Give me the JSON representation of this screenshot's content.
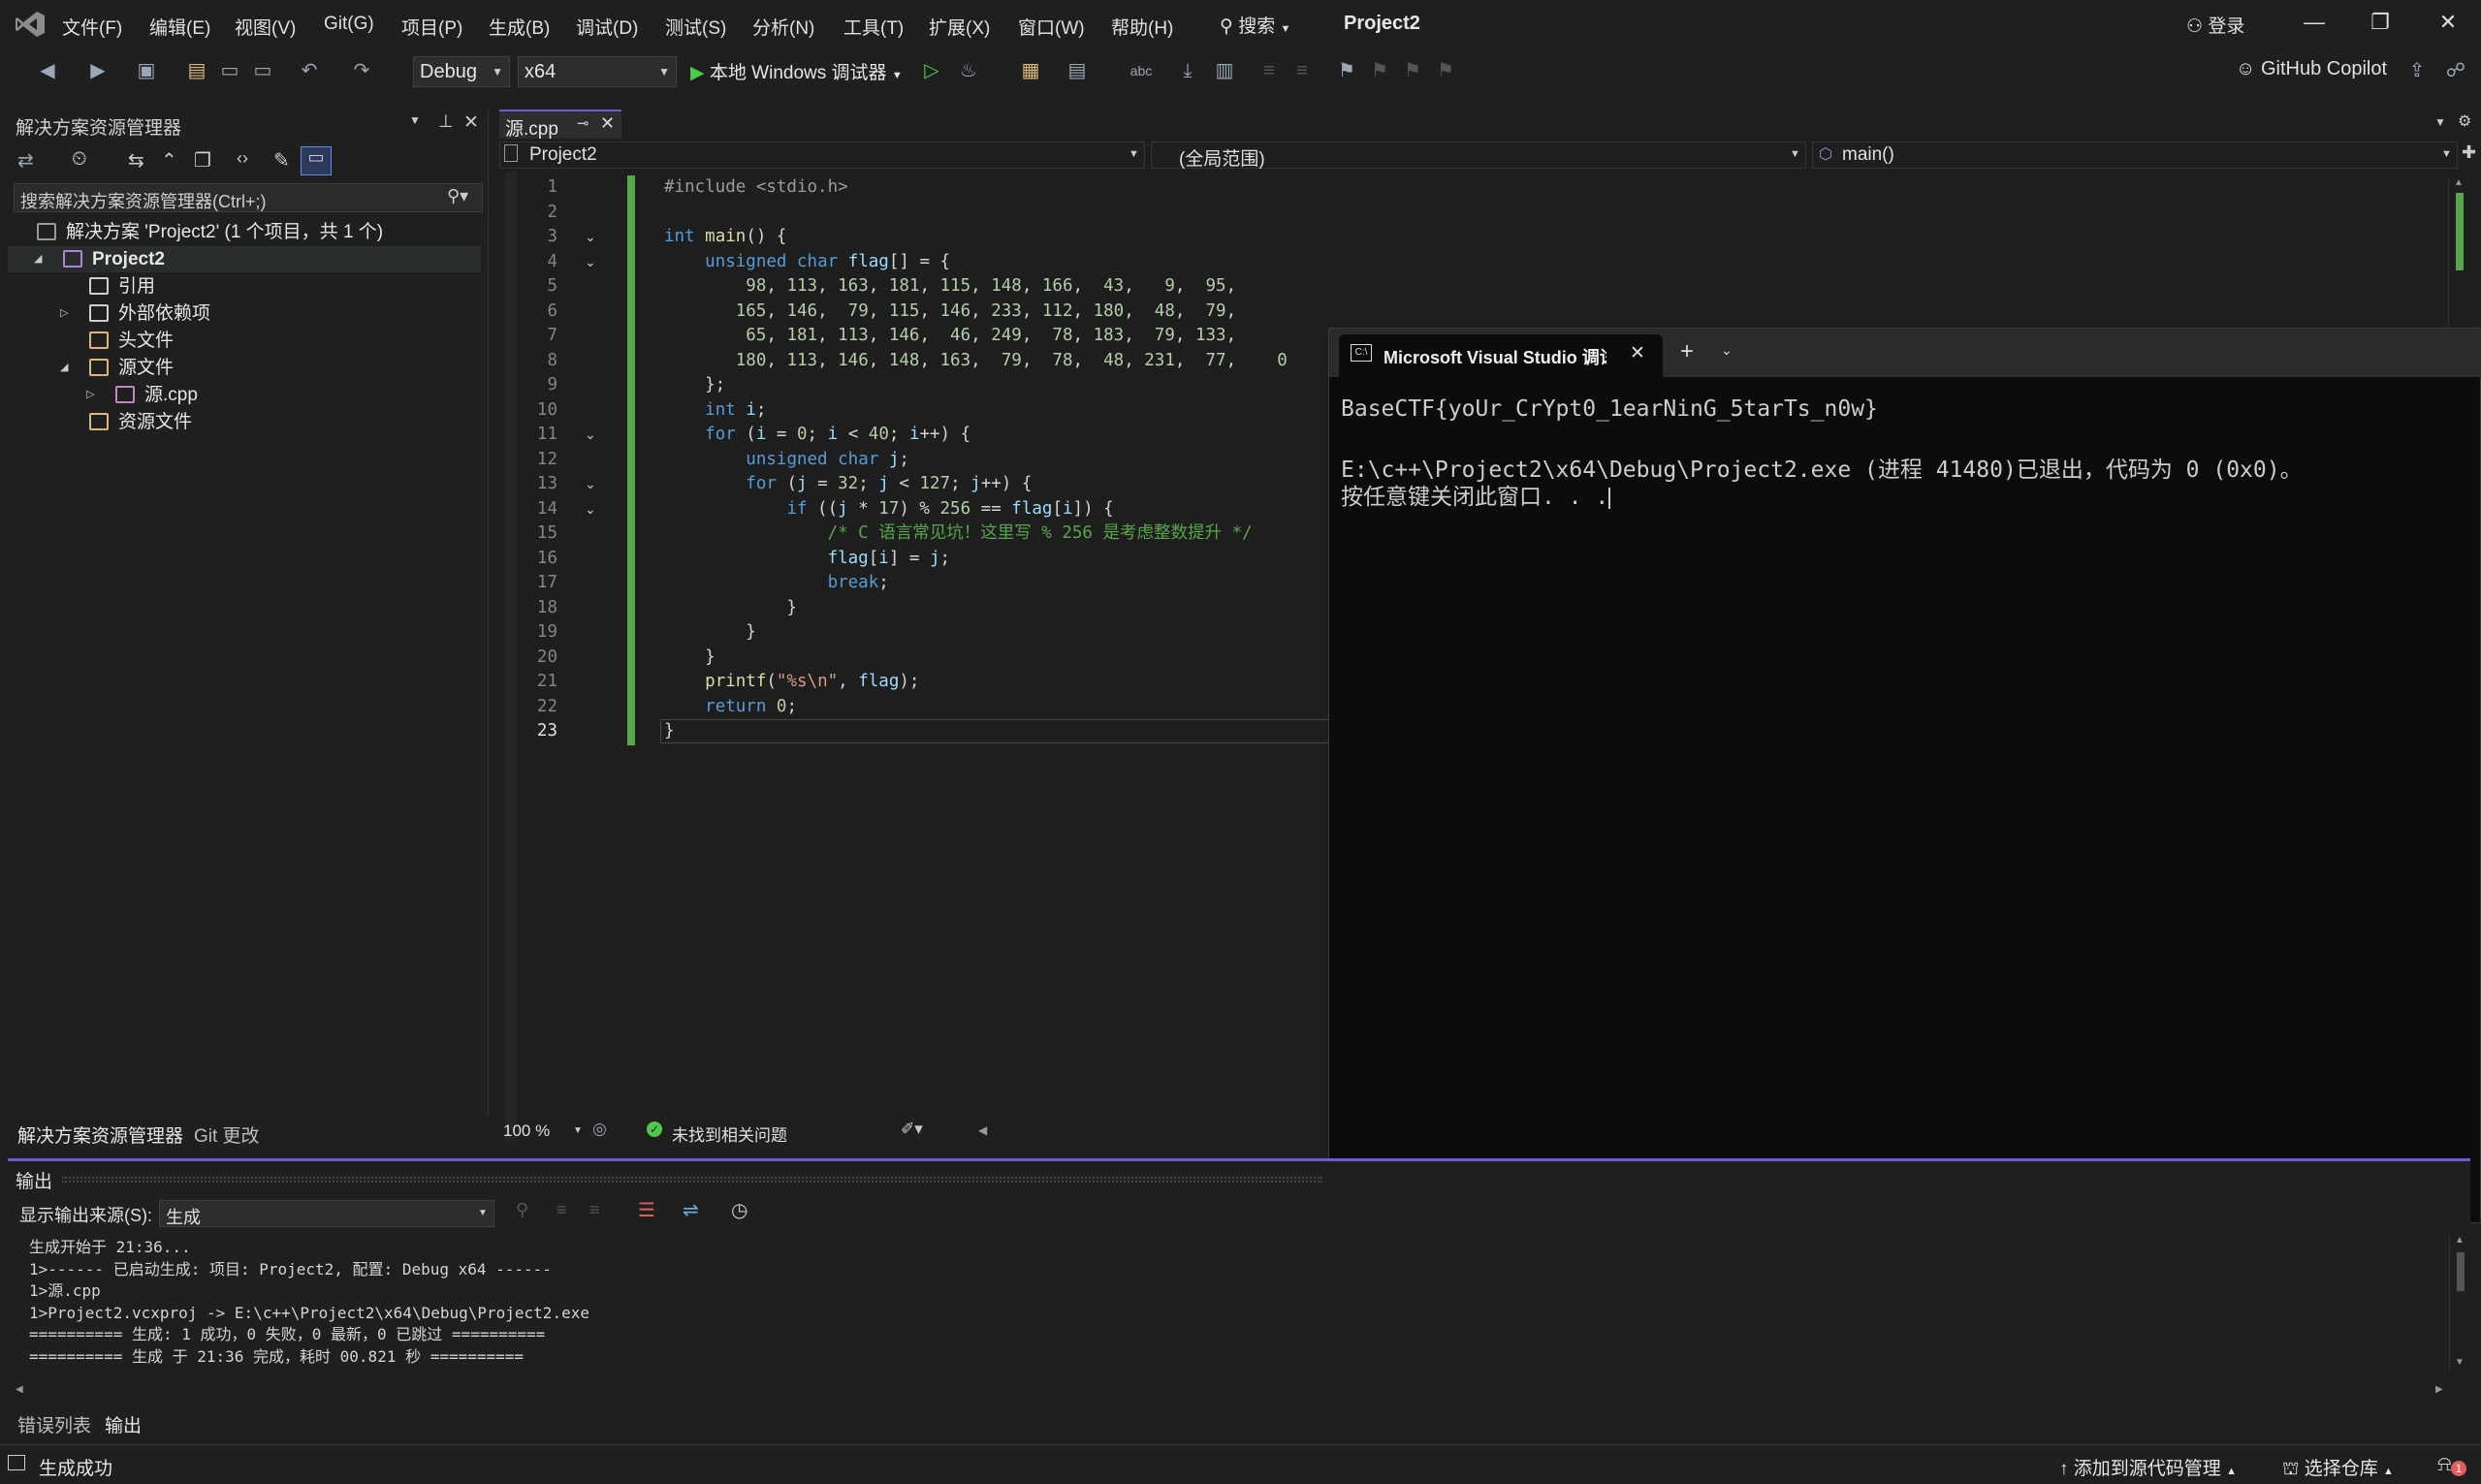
{
  "titlebar": {
    "menus": [
      "文件(F)",
      "编辑(E)",
      "视图(V)",
      "Git(G)",
      "项目(P)",
      "生成(B)",
      "调试(D)",
      "测试(S)",
      "分析(N)",
      "工具(T)",
      "扩展(X)",
      "窗口(W)",
      "帮助(H)"
    ],
    "search_label": "搜索",
    "project_name": "Project2",
    "login_label": "登录"
  },
  "toolbar": {
    "config": "Debug",
    "platform": "x64",
    "debugger_label": "本地 Windows 调试器",
    "copilot_label": "GitHub Copilot"
  },
  "solution_explorer": {
    "title": "解决方案资源管理器",
    "search_placeholder": "搜索解决方案资源管理器(Ctrl+;)",
    "tree": [
      {
        "label": "解决方案 'Project2' (1 个项目，共 1 个)",
        "indent": 0,
        "icon_color": "#9b9b9b"
      },
      {
        "label": "Project2",
        "indent": 1,
        "icon_color": "#b180d7",
        "bold": true
      },
      {
        "label": "引用",
        "indent": 2,
        "icon_color": "#cfcfcf"
      },
      {
        "label": "外部依赖项",
        "indent": 2,
        "icon_color": "#cfcfcf"
      },
      {
        "label": "头文件",
        "indent": 2,
        "icon_color": "#dcb67a"
      },
      {
        "label": "源文件",
        "indent": 2,
        "icon_color": "#dcb67a"
      },
      {
        "label": "源.cpp",
        "indent": 3,
        "icon_color": "#c586c0"
      },
      {
        "label": "资源文件",
        "indent": 2,
        "icon_color": "#dcb67a"
      }
    ],
    "bottom_tabs": [
      "解决方案资源管理器",
      "Git 更改"
    ]
  },
  "editor": {
    "tab_label": "源.cpp",
    "nav_project": "Project2",
    "nav_scope": "(全局范围)",
    "nav_member": "main()",
    "zoom": "100 %",
    "issues": "未找到相关问题",
    "lines": [
      "#include <stdio.h>",
      "",
      "int main() {",
      "    unsigned char flag[] = {",
      "        98, 113, 163, 181, 115, 148, 166,  43,   9,  95,",
      "       165, 146,  79, 115, 146, 233, 112, 180,  48,  79,",
      "        65, 181, 113, 146,  46, 249,  78, 183,  79, 133,",
      "       180, 113, 146, 148, 163,  79,  78,  48, 231,  77,    0",
      "    };",
      "    int i;",
      "    for (i = 0; i < 40; i++) {",
      "        unsigned char j;",
      "        for (j = 32; j < 127; j++) {",
      "            if ((j * 17) % 256 == flag[i]) {",
      "                /* C 语言常见坑！这里写 % 256 是考虑整数提升 */",
      "                flag[i] = j;",
      "                break;",
      "            }",
      "        }",
      "    }",
      "    printf(\"%s\\n\", flag);",
      "    return 0;",
      "}"
    ]
  },
  "console": {
    "tab_title": "Microsoft Visual Studio 调试控制台",
    "output_line1": "BaseCTF{yoUr_CrYpt0_1earNinG_5tarTs_n0w}",
    "output_line2": "E:\\c++\\Project2\\x64\\Debug\\Project2.exe (进程 41480)已退出，代码为 0 (0x0)。",
    "output_line3": "按任意键关闭此窗口. . ."
  },
  "output_panel": {
    "title": "输出",
    "source_label": "显示输出来源(S):",
    "source_value": "生成",
    "lines": [
      "生成开始于 21:36...",
      "1>------ 已启动生成: 项目: Project2, 配置: Debug x64 ------",
      "1>源.cpp",
      "1>Project2.vcxproj -> E:\\c++\\Project2\\x64\\Debug\\Project2.exe",
      "========== 生成: 1 成功，0 失败，0 最新，0 已跳过 ==========",
      "========== 生成 于 21:36 完成，耗时 00.821 秒 =========="
    ],
    "bottom_tabs": [
      "错误列表",
      "输出"
    ]
  },
  "statusbar": {
    "status": "生成成功",
    "add_source": "添加到源代码管理",
    "select_repo": "选择仓库",
    "notif_count": "1"
  }
}
